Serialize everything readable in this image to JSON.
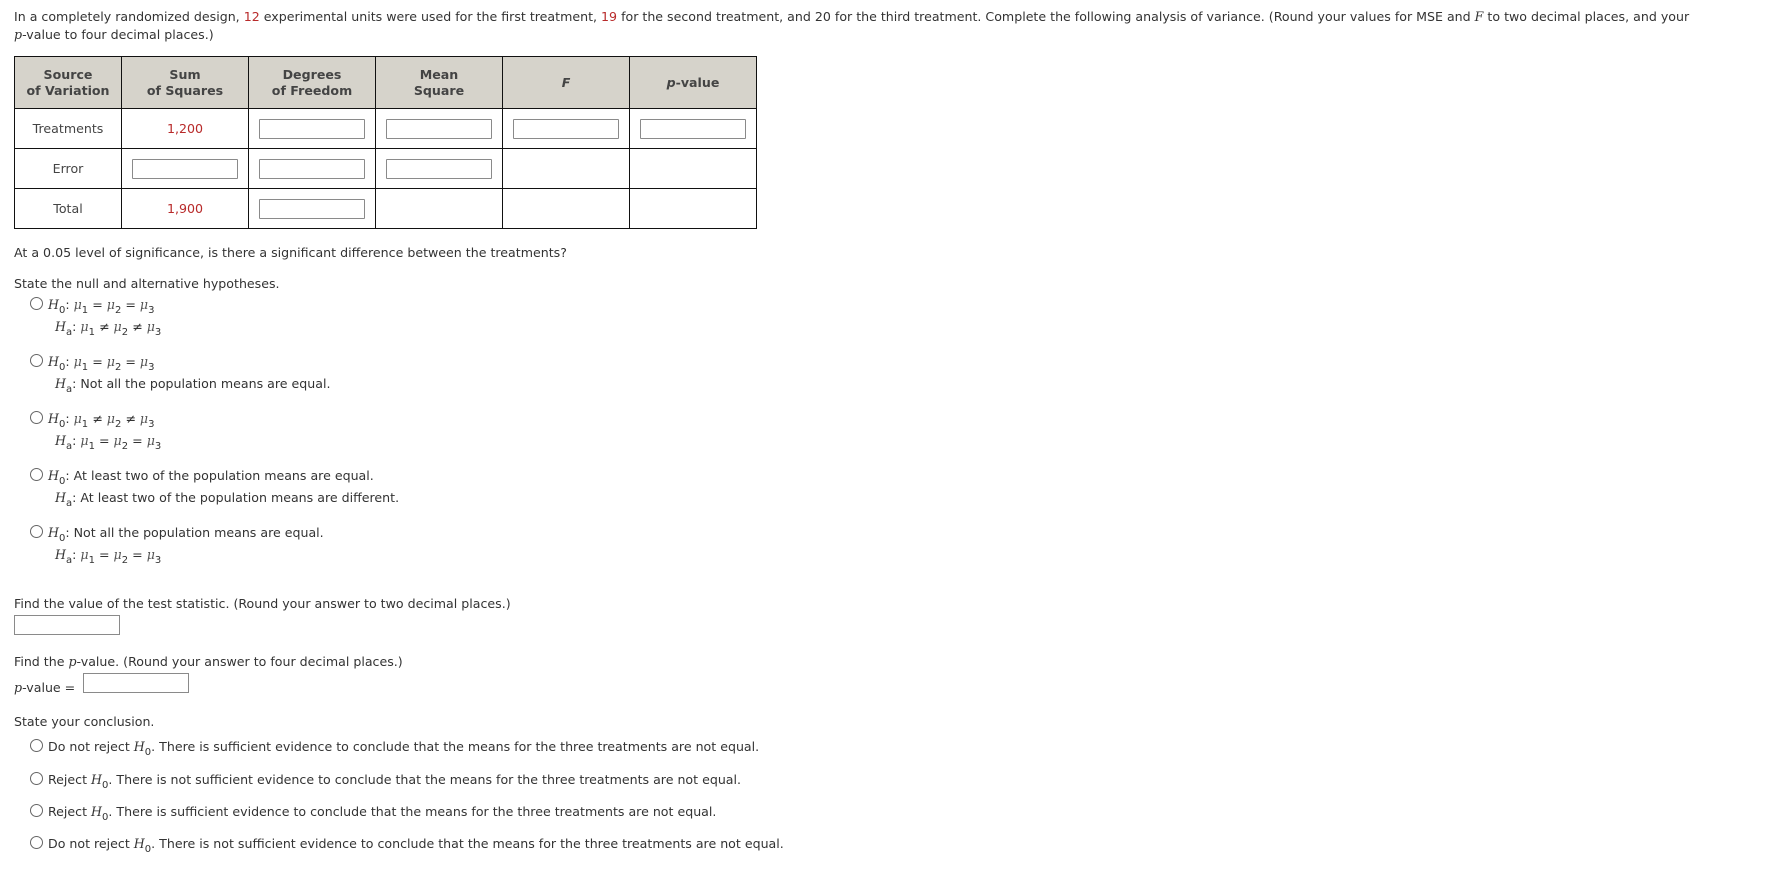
{
  "intro": {
    "part1": "In a completely randomized design, ",
    "n1": "12",
    "part2": " experimental units were used for the first treatment, ",
    "n2": "19",
    "part3": " for the second treatment, and 20 for the third treatment. Complete the following analysis of variance. (Round your values for MSE and ",
    "F": "F",
    "part4": " to two decimal places, and your",
    "p": "p",
    "part5": "-value to four decimal places.)"
  },
  "table": {
    "headers": {
      "source": [
        "Source",
        "of Variation"
      ],
      "ss": [
        "Sum",
        "of Squares"
      ],
      "df": [
        "Degrees",
        "of Freedom"
      ],
      "ms": [
        "Mean",
        "Square"
      ],
      "f": "F",
      "p_italic": "p",
      "p_rest": "-value"
    },
    "rows": [
      {
        "label": "Treatments",
        "ss": "1,200"
      },
      {
        "label": "Error",
        "ss": ""
      },
      {
        "label": "Total",
        "ss": "1,900"
      }
    ]
  },
  "significance_question": "At a 0.05 level of significance, is there a significant difference between the treatments?",
  "hypotheses": {
    "prompt": "State the null and alternative hypotheses.",
    "H": "H",
    "zero": "0",
    "a": "a",
    "options": [
      {
        "h0": "μ1 = μ2 = μ3",
        "ha": "μ1 ≠ μ2 ≠ μ3"
      },
      {
        "h0": "μ1 = μ2 = μ3",
        "ha": "Not all the population means are equal."
      },
      {
        "h0": "μ1 ≠ μ2 ≠ μ3",
        "ha": "μ1 = μ2 = μ3"
      },
      {
        "h0": "At least two of the population means are equal.",
        "ha": "At least two of the population means are different."
      },
      {
        "h0": "Not all the population means are equal.",
        "ha": "μ1 = μ2 = μ3"
      }
    ]
  },
  "test_statistic": {
    "prompt": "Find the value of the test statistic. (Round your answer to two decimal places.)",
    "value": ""
  },
  "p_value": {
    "prompt_pre": "Find the ",
    "prompt_p": "p",
    "prompt_post": "-value. (Round your answer to four decimal places.)",
    "label_p": "p",
    "label_rest": "-value =",
    "value": ""
  },
  "conclusion": {
    "prompt": "State your conclusion.",
    "options": [
      {
        "action": "Do not reject ",
        "text": ". There is sufficient evidence to conclude that the means for the three treatments are not equal."
      },
      {
        "action": "Reject ",
        "text": ". There is not sufficient evidence to conclude that the means for the three treatments are not equal."
      },
      {
        "action": "Reject ",
        "text": ". There is sufficient evidence to conclude that the means for the three treatments are not equal."
      },
      {
        "action": "Do not reject ",
        "text": ". There is not sufficient evidence to conclude that the means for the three treatments are not equal."
      }
    ]
  },
  "colors": {
    "given_value": "#b82a2a",
    "table_header_bg": "#d6d3cb"
  }
}
